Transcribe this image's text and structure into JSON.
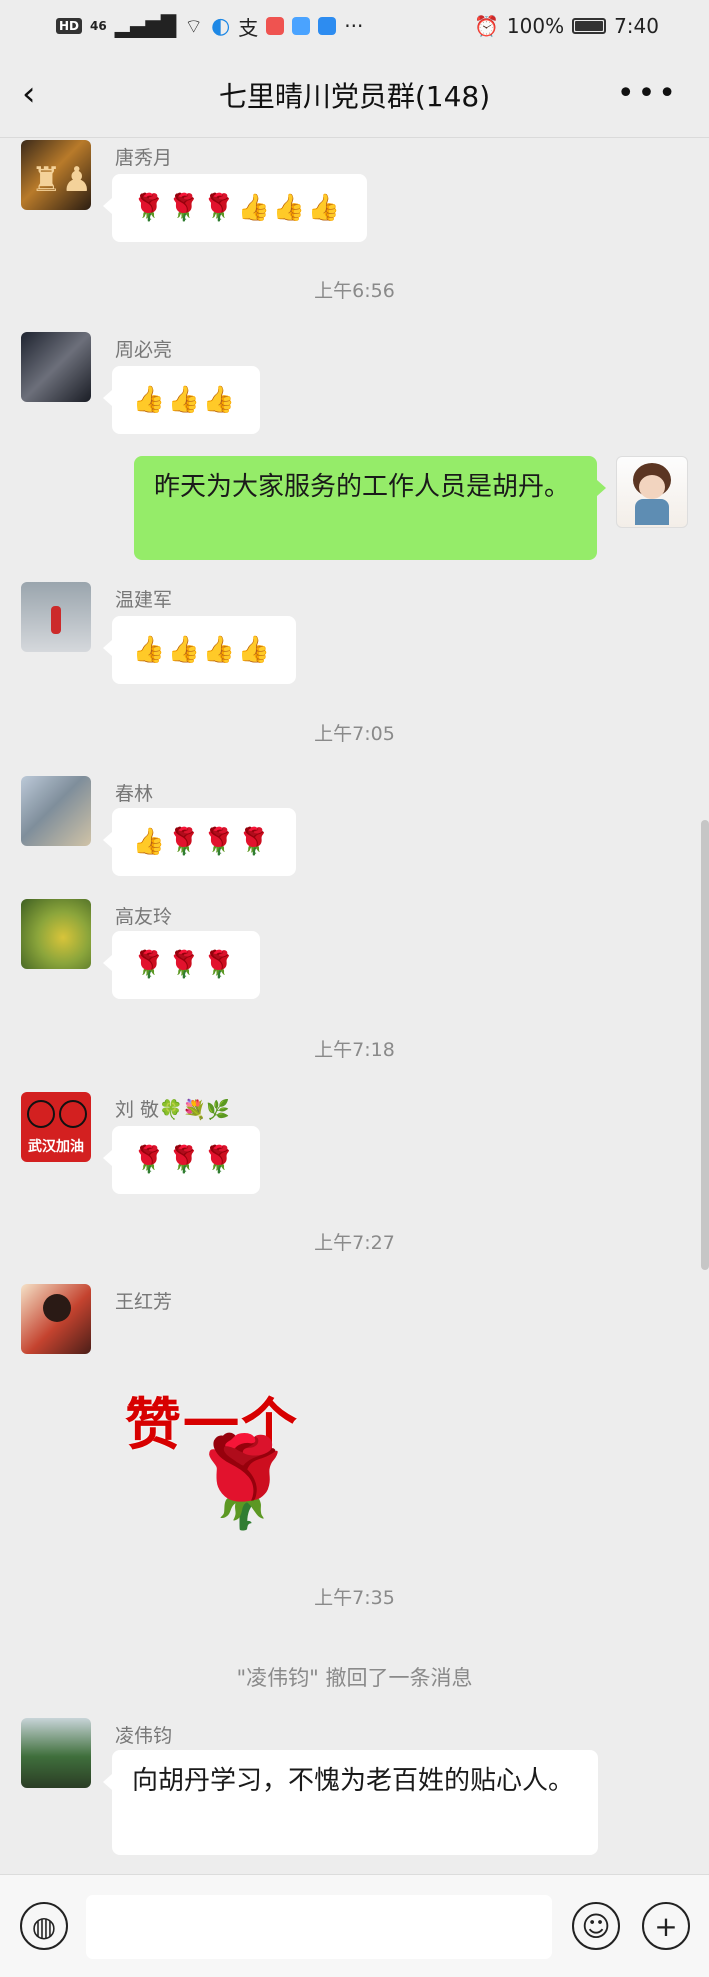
{
  "status": {
    "left": [
      "HD",
      "46",
      "支"
    ],
    "battery": "100%",
    "time": "7:40",
    "colors": {
      "app1": "#ef5350",
      "app2": "#4aa3ff",
      "app3": "#2d8cf0"
    }
  },
  "header": {
    "title": "七里晴川党员群(148)"
  },
  "messages": [
    {
      "sender": "唐秀月",
      "content": [
        "🌹",
        "🌹",
        "🌹",
        "👍",
        "👍",
        "👍"
      ]
    },
    {
      "time": "上午6:56"
    },
    {
      "sender": "周必亮",
      "content": [
        "👍",
        "👍",
        "👍"
      ]
    },
    {
      "self": "昨天为大家服务的工作人员是胡丹。"
    },
    {
      "sender": "温建军",
      "content": [
        "👍",
        "👍",
        "👍",
        "👍"
      ]
    },
    {
      "time": "上午7:05"
    },
    {
      "sender": "春林",
      "content": [
        "👍",
        "🌹",
        "🌹",
        "🌹"
      ]
    },
    {
      "sender": "高友玲",
      "content": [
        "🌹",
        "🌹",
        "🌹"
      ]
    },
    {
      "time": "上午7:18"
    },
    {
      "sender": "刘  敬🍀💐🌿",
      "content": [
        "🌹",
        "🌹",
        "🌹"
      ]
    },
    {
      "time": "上午7:27"
    },
    {
      "sender": "王红芳",
      "sticker_text": "赞一个"
    },
    {
      "time": "上午7:35"
    },
    {
      "recall": "\"凌伟钧\" 撤回了一条消息"
    },
    {
      "sender": "凌伟钧",
      "text": "向胡丹学习，不愧为老百姓的贴心人。"
    }
  ],
  "sticker_labels": [
    "武汉加油"
  ],
  "colors": {
    "background": "#ededed",
    "bubble": "#ffffff",
    "self_bubble": "#95ec69"
  },
  "input": {
    "placeholder": ""
  }
}
